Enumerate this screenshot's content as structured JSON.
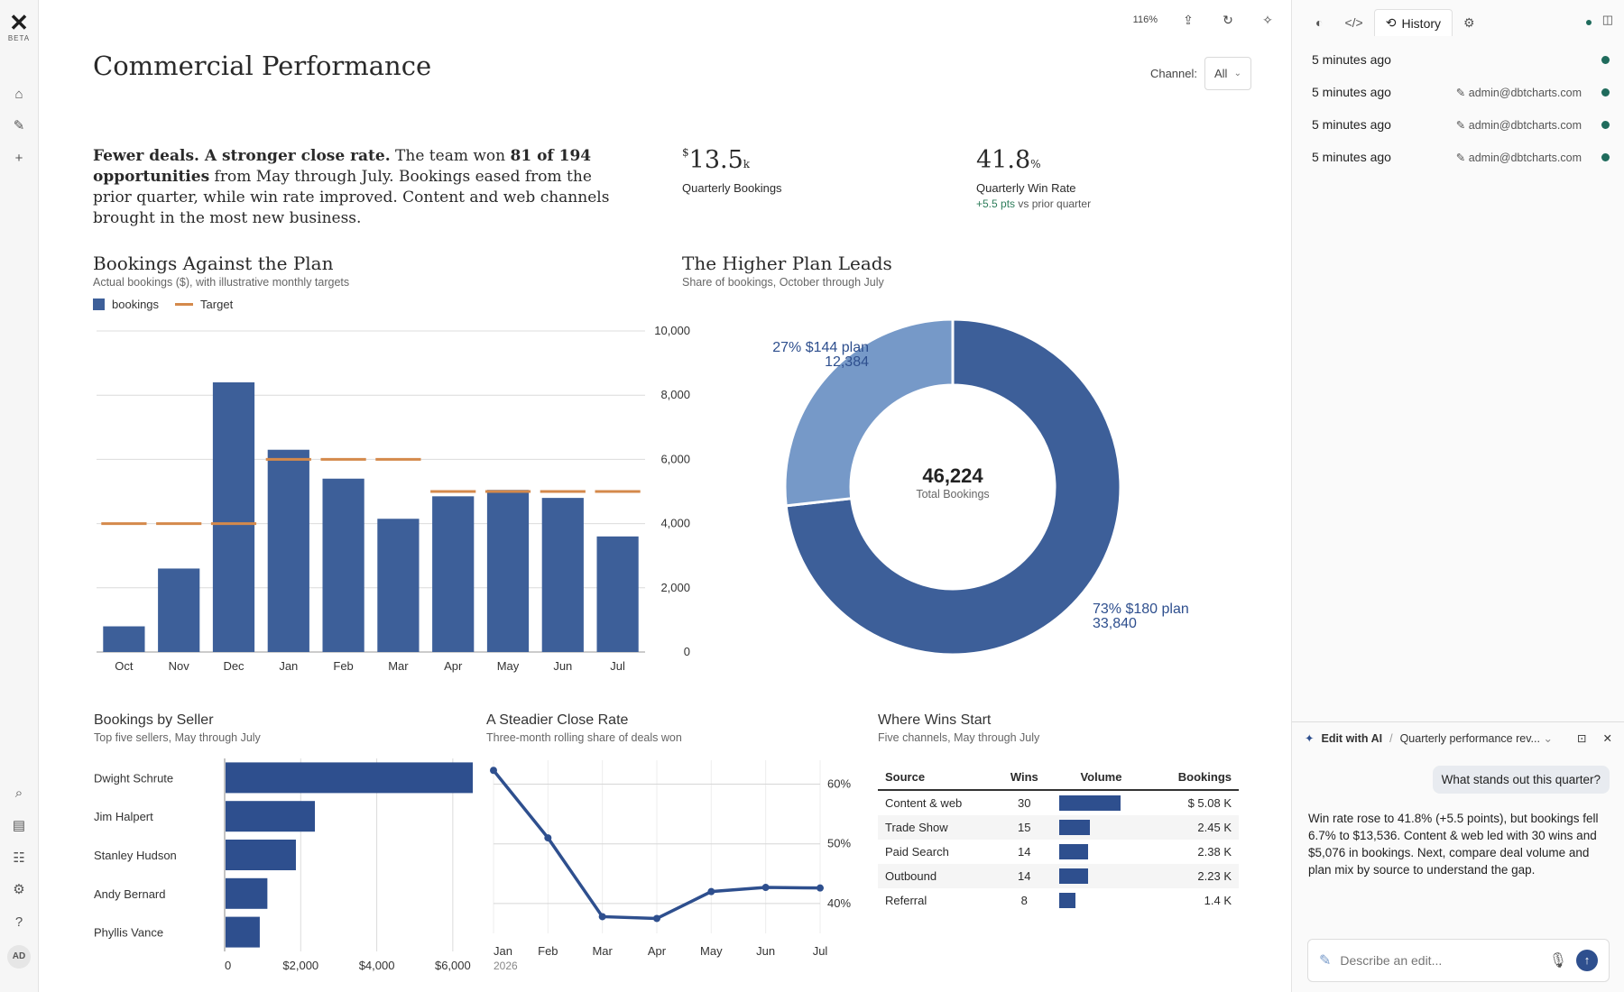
{
  "rail": {
    "logo_text": "BETA",
    "avatar": "AD",
    "icons": [
      "home-icon",
      "edit-icon",
      "plus-icon",
      "search-icon",
      "database-icon",
      "stack-icon",
      "gear-icon",
      "help-icon"
    ]
  },
  "toolbar": {
    "zoom": "116%"
  },
  "page": {
    "title": "Commercial Performance",
    "channel_label": "Channel:",
    "channel_value": "All"
  },
  "intro": {
    "lead": "Fewer deals. A stronger close rate.",
    "t1": " The team won ",
    "bold2": "81 of 194 opportunities",
    "t2": " from May through July. Bookings eased from the prior quarter, while win rate improved. Content and web channels brought in the most new business."
  },
  "kpis": {
    "bookings": {
      "prefix": "$",
      "value": "13.5",
      "suffix": "k",
      "label": "Quarterly Bookings"
    },
    "winrate": {
      "value": "41.8",
      "suffix": "%",
      "label": "Quarterly Win Rate",
      "delta": "+5.5 pts",
      "delta_rest": " vs prior quarter"
    }
  },
  "sections": {
    "bookings_plan": {
      "title": "Bookings Against the Plan",
      "subtitle": "Actual bookings ($), with illustrative monthly targets"
    },
    "higher_plan": {
      "title": "The Higher Plan Leads",
      "subtitle": "Share of bookings, October through July"
    },
    "by_seller": {
      "title": "Bookings by Seller",
      "subtitle": "Top five sellers, May through July"
    },
    "close_rate": {
      "title": "A Steadier Close Rate",
      "subtitle": "Three-month rolling share of deals won"
    },
    "wins_start": {
      "title": "Where Wins Start",
      "subtitle": "Five channels, May through July"
    }
  },
  "chart_data": [
    {
      "id": "bookings-vs-plan",
      "type": "bar",
      "categories": [
        "Oct",
        "Nov",
        "Dec",
        "Jan",
        "Feb",
        "Mar",
        "Apr",
        "May",
        "Jun",
        "Jul"
      ],
      "series": [
        {
          "name": "bookings",
          "values": [
            800,
            2600,
            8400,
            6300,
            5400,
            4150,
            4850,
            5050,
            4800,
            3600
          ]
        },
        {
          "name": "Target",
          "values": [
            4000,
            4000,
            4000,
            6000,
            6000,
            6000,
            5000,
            5000,
            5000,
            5000
          ]
        }
      ],
      "ylim": [
        0,
        10000
      ],
      "yticks": [
        "0",
        "2,000",
        "4,000",
        "6,000",
        "8,000",
        "10,000"
      ],
      "colors": {
        "bookings": "#3d5f99",
        "Target": "#d4894b"
      },
      "legend": "top-left",
      "grid": true
    },
    {
      "id": "plan-share",
      "type": "pie",
      "slices": [
        {
          "label": "$180 plan",
          "pct": "73%",
          "value": 33840,
          "value_label": "33,840",
          "color": "#3d5f99"
        },
        {
          "label": "$144 plan",
          "pct": "27%",
          "value": 12384,
          "value_label": "12,384",
          "color": "#7699c8"
        }
      ],
      "center_value": "46,224",
      "center_label": "Total Bookings"
    },
    {
      "id": "by-seller",
      "type": "bar",
      "orientation": "horizontal",
      "categories": [
        "Dwight Schrute",
        "Jim Halpert",
        "Stanley Hudson",
        "Andy Bernard",
        "Phyllis Vance"
      ],
      "values": [
        6550,
        2350,
        1850,
        1100,
        900
      ],
      "xlim": [
        0,
        7000
      ],
      "xticks": [
        "0",
        "$2,000",
        "$4,000",
        "$6,000"
      ],
      "color": "#2e4f8e"
    },
    {
      "id": "close-rate",
      "type": "line",
      "x": [
        "Jan",
        "Feb",
        "Mar",
        "Apr",
        "May",
        "Jun",
        "Jul"
      ],
      "values": [
        62.3,
        51.0,
        37.8,
        37.5,
        42.0,
        42.7,
        42.6
      ],
      "ylim": [
        35,
        64
      ],
      "yticks": [
        "40%",
        "50%",
        "60%"
      ],
      "xsub": "2026",
      "color": "#2e4f8e"
    }
  ],
  "source_table": {
    "headers": [
      "Source",
      "Wins",
      "Volume",
      "Bookings"
    ],
    "rows": [
      {
        "source": "Content & web",
        "wins": "30",
        "volume": 30,
        "bookings": "$ 5.08 K"
      },
      {
        "source": "Trade Show",
        "wins": "15",
        "volume": 15,
        "bookings": "2.45 K"
      },
      {
        "source": "Paid Search",
        "wins": "14",
        "volume": 14,
        "bookings": "2.38 K"
      },
      {
        "source": "Outbound",
        "wins": "14",
        "volume": 14,
        "bookings": "2.23 K"
      },
      {
        "source": "Referral",
        "wins": "8",
        "volume": 8,
        "bookings": "1.4   K"
      }
    ]
  },
  "panel": {
    "tabs": [
      "History"
    ],
    "history": [
      {
        "time": "5 minutes ago",
        "user": ""
      },
      {
        "time": "5 minutes ago",
        "user": "admin@dbtcharts.com"
      },
      {
        "time": "5 minutes ago",
        "user": "admin@dbtcharts.com"
      },
      {
        "time": "5 minutes ago",
        "user": "admin@dbtcharts.com"
      }
    ],
    "ai": {
      "title": "Edit with AI",
      "sep": "/",
      "doc": "Quarterly performance rev...",
      "question": "What stands out this quarter?",
      "answer": "Win rate rose to 41.8% (+5.5 points), but bookings fell 6.7% to $13,536. Content & web led with 30 wins and $5,076 in bookings. Next, compare deal volume and plan mix by source to understand the gap.",
      "placeholder": "Describe an edit..."
    }
  }
}
